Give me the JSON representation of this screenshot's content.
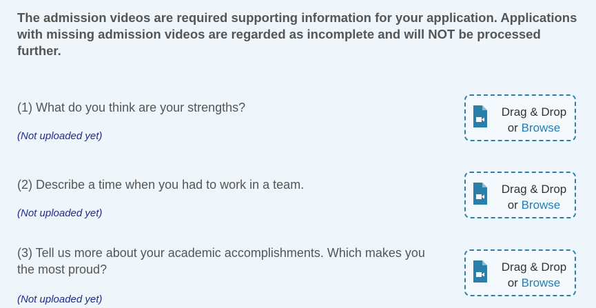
{
  "notice": "The admission videos are required supporting information for your application. Applications with missing admission videos are regarded as incomplete and will NOT be processed further.",
  "questions": [
    {
      "text": "(1) What do you think are your strengths?",
      "status": "(Not uploaded yet)"
    },
    {
      "text": "(2) Describe a time when you had to work in a team.",
      "status": "(Not uploaded yet)"
    },
    {
      "text": "(3) Tell us more about your academic accomplishments. Which makes you the most proud?",
      "status": "(Not uploaded yet)"
    }
  ],
  "dropzone": {
    "drag_label": "Drag & Drop",
    "or_label": "or",
    "browse_label": "Browse",
    "icon": "video-file-icon"
  },
  "colors": {
    "accent": "#2a7fa8",
    "status": "#1f2b8a",
    "link": "#1f7fb6"
  }
}
